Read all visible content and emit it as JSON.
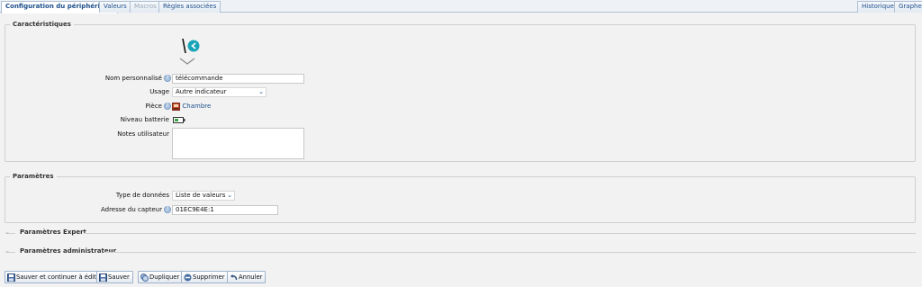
{
  "tabs_left": [
    {
      "label": "Configuration du périphérique",
      "state": "active"
    },
    {
      "label": "Valeurs",
      "state": "normal"
    },
    {
      "label": "Macros",
      "state": "disabled"
    },
    {
      "label": "Règles associées",
      "state": "normal"
    }
  ],
  "tabs_right": [
    {
      "label": "Historique"
    },
    {
      "label": "Graphe"
    }
  ],
  "caracteristiques": {
    "legend": "Caractéristiques",
    "nom_label": "Nom personnalisé",
    "nom_value": "télécommande",
    "usage_label": "Usage",
    "usage_value": "Autre indicateur",
    "piece_label": "Pièce",
    "piece_value": "Chambre",
    "batterie_label": "Niveau batterie",
    "notes_label": "Notes utilisateur",
    "notes_value": ""
  },
  "parametres": {
    "legend": "Paramètres",
    "type_label": "Type de données",
    "type_value": "Liste de valeurs",
    "adresse_label": "Adresse du capteur",
    "adresse_value": "01EC9E4E:1"
  },
  "expert": {
    "legend": "Paramètres Expert"
  },
  "admin": {
    "legend": "Paramètres administrateur"
  },
  "buttons": {
    "save_continue": "Sauver et continuer à éditer",
    "save": "Sauver",
    "duplicate": "Dupliquer",
    "delete": "Supprimer",
    "cancel": "Annuler"
  },
  "colors": {
    "tab_text": "#1d4f8c",
    "accent_teal": "#1aa4b8",
    "battery_green": "#3aa845"
  },
  "icons": {
    "help": "question-circle-icon",
    "room": "room-icon",
    "battery": "battery-icon",
    "device": "remote-control-icon",
    "save": "floppy-disk-icon",
    "duplicate": "duplicate-icon",
    "delete": "minus-circle-icon",
    "cancel": "undo-arrow-icon"
  }
}
